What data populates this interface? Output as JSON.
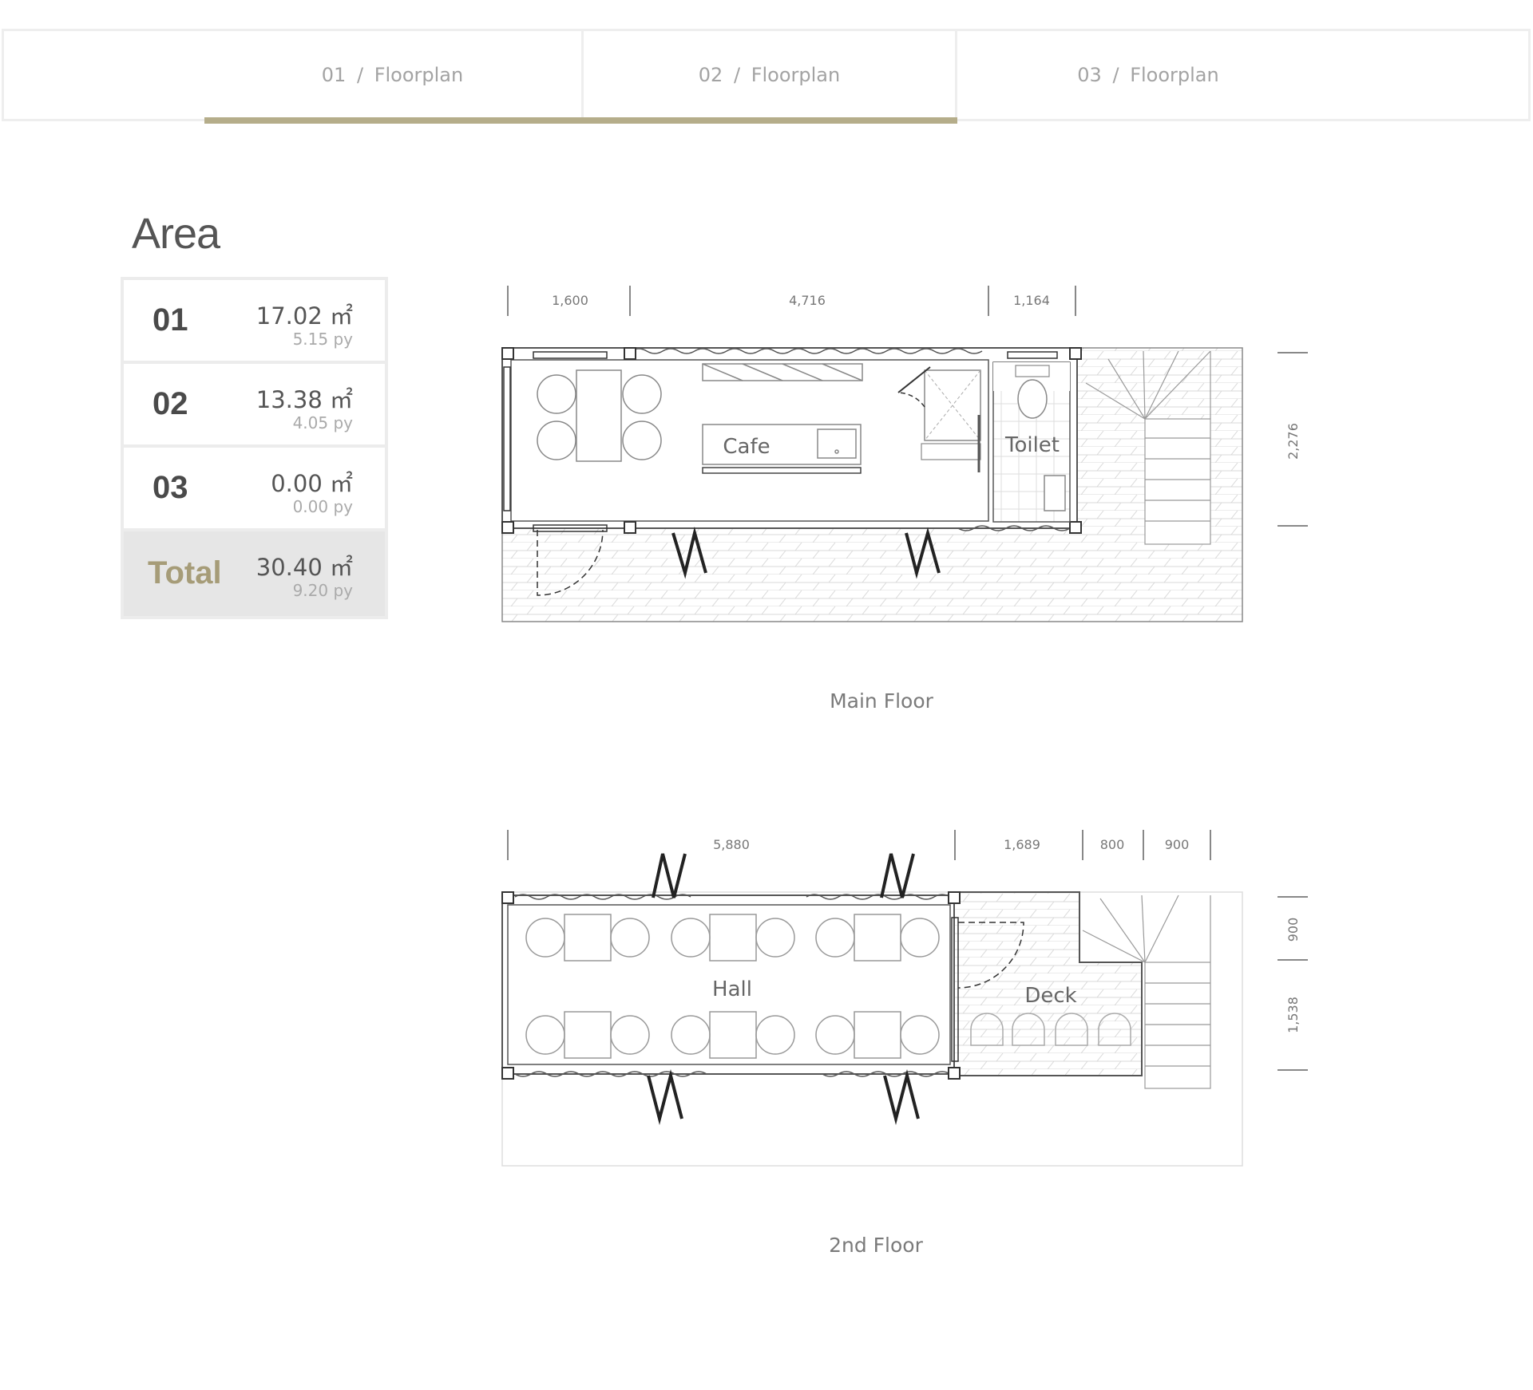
{
  "tabs": [
    {
      "num": "01",
      "sep": "/",
      "label": "Floorplan"
    },
    {
      "num": "02",
      "sep": "/",
      "label": "Floorplan"
    },
    {
      "num": "03",
      "sep": "/",
      "label": "Floorplan"
    }
  ],
  "area": {
    "title": "Area",
    "rows": [
      {
        "label": "01",
        "m2": "17.02 ㎡",
        "py": "5.15 py"
      },
      {
        "label": "02",
        "m2": "13.38 ㎡",
        "py": "4.05 py"
      },
      {
        "label": "03",
        "m2": "0.00 ㎡",
        "py": "0.00 py"
      }
    ],
    "total": {
      "label": "Total",
      "m2": "30.40 ㎡",
      "py": "9.20 py"
    }
  },
  "main_floor": {
    "caption": "Main Floor",
    "dims_top": [
      "1,600",
      "4,716",
      "1,164"
    ],
    "dim_side": "2,276",
    "rooms": {
      "cafe": "Cafe",
      "toilet": "Toilet"
    }
  },
  "second_floor": {
    "caption": "2nd Floor",
    "dims_top": [
      "5,880",
      "1,689",
      "800",
      "900"
    ],
    "dims_side": [
      "900",
      "1,538"
    ],
    "rooms": {
      "hall": "Hall",
      "deck": "Deck"
    }
  },
  "colors": {
    "accent": "#b5ad8a",
    "total_label": "#a69c78",
    "line": "#555555"
  }
}
